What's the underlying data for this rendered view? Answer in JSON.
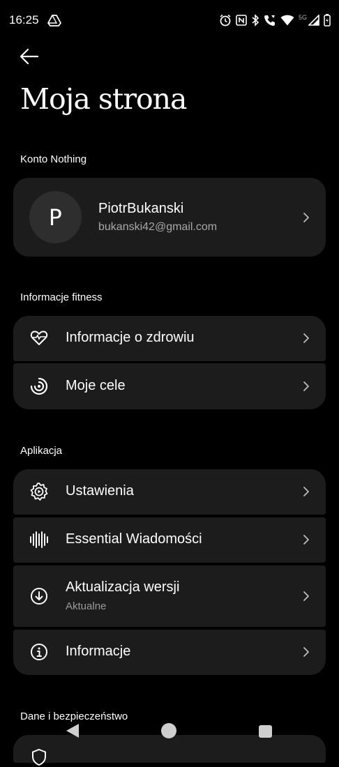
{
  "status_bar": {
    "time": "16:25",
    "network": "5G",
    "icons": [
      "drive-icon",
      "alarm-icon",
      "nfc-icon",
      "bluetooth-icon",
      "wifi-call-icon",
      "wifi-icon",
      "signal-icon",
      "battery-icon"
    ]
  },
  "header": {
    "title": "Moja strona",
    "back_icon": "arrow-left-icon"
  },
  "account": {
    "section": "Konto Nothing",
    "avatar_letter": "P",
    "username": "PiotrBukanski",
    "email": "bukanski42@gmail.com"
  },
  "fitness": {
    "section": "Informacje fitness",
    "items": [
      {
        "label": "Informacje o zdrowiu",
        "icon": "heart-icon"
      },
      {
        "label": "Moje cele",
        "icon": "goals-icon"
      }
    ]
  },
  "app": {
    "section": "Aplikacja",
    "items": [
      {
        "label": "Ustawienia",
        "icon": "gear-icon"
      },
      {
        "label": "Essential Wiadomości",
        "icon": "waveform-icon"
      },
      {
        "label": "Aktualizacja wersji",
        "sub": "Aktualne",
        "icon": "download-icon"
      },
      {
        "label": "Informacje",
        "icon": "info-icon"
      }
    ]
  },
  "security": {
    "section": "Dane i bezpieczeństwo"
  },
  "nav": {
    "icons": [
      "nav-back-icon",
      "nav-home-icon",
      "nav-recents-icon"
    ]
  },
  "colors": {
    "background": "#000000",
    "card": "#1c1c1d",
    "text": "#ffffff",
    "secondary": "#9a9a9a"
  }
}
